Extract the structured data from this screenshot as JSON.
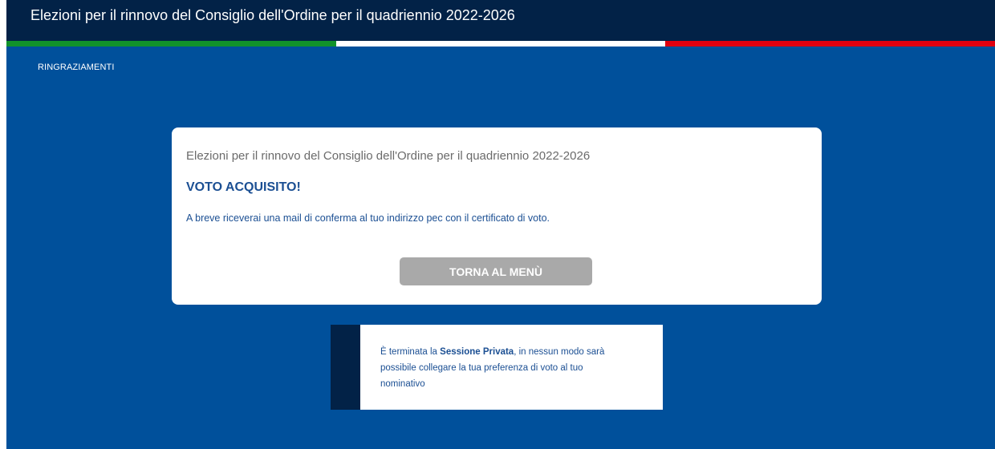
{
  "header": {
    "title": "Elezioni per il rinnovo del Consiglio dell'Ordine per il quadriennio 2022-2026",
    "flag_colors": [
      "#11922b",
      "#ffffff",
      "#e1000f"
    ]
  },
  "page": {
    "section_label": "RINGRAZIAMENTI"
  },
  "card": {
    "title": "Elezioni per il rinnovo del Consiglio dell'Ordine per il quadriennio 2022-2026",
    "heading": "VOTO ACQUISITO!",
    "message": "A breve riceverai una mail di conferma al tuo indirizzo pec con il certificato di voto.",
    "button_label": "TORNA AL MENÙ"
  },
  "notice": {
    "prefix": "È terminata la ",
    "bold": "Sessione Privata",
    "suffix": ", in nessun modo sarà possibile collegare la tua preferenza di voto al tuo nominativo"
  },
  "colors": {
    "background": "#00509b",
    "topbar": "#022247",
    "accent_text": "#1b4f93",
    "button": "#a9a9a9"
  }
}
